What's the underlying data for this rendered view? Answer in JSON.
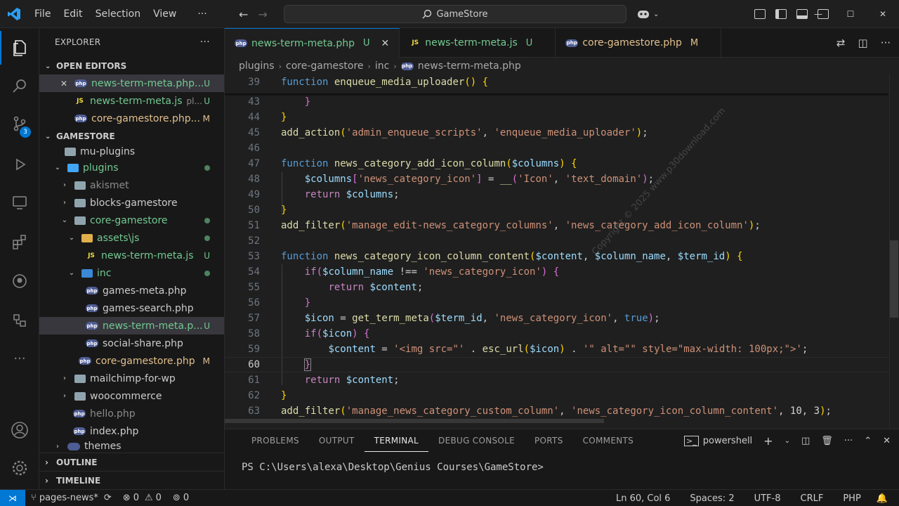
{
  "menu": [
    "File",
    "Edit",
    "Selection",
    "View"
  ],
  "menu_more": "···",
  "search": {
    "text": "GameStore"
  },
  "window": {
    "minimize": "—",
    "maximize": "☐",
    "close": "✕"
  },
  "activity": {
    "scm_badge": "3"
  },
  "explorer": {
    "title": "EXPLORER",
    "more": "···",
    "open_editors_title": "OPEN EDITORS",
    "open_editors": [
      {
        "name": "news-term-meta.php...",
        "status": "U",
        "close": "✕"
      },
      {
        "name": "news-term-meta.js",
        "hint": "pl...",
        "status": "U"
      },
      {
        "name": "core-gamestore.php...",
        "status": "M"
      }
    ],
    "workspace_title": "GAMESTORE",
    "tree": {
      "mu_plugins": "mu-plugins",
      "plugins": "plugins",
      "akismet": "akismet",
      "blocks_gamestore": "blocks-gamestore",
      "core_gamestore": "core-gamestore",
      "assets_js": "assets\\js",
      "news_term_meta_js": "news-term-meta.js",
      "news_term_meta_js_status": "U",
      "inc": "inc",
      "games_meta": "games-meta.php",
      "games_search": "games-search.php",
      "news_term_meta_php": "news-term-meta.p...",
      "news_term_meta_php_status": "U",
      "social_share": "social-share.php",
      "core_gamestore_php": "core-gamestore.php",
      "core_gamestore_php_status": "M",
      "mailchimp": "mailchimp-for-wp",
      "woocommerce": "woocommerce",
      "hello": "hello.php",
      "index": "index.php",
      "themes": "themes"
    },
    "outline": "OUTLINE",
    "timeline": "TIMELINE"
  },
  "tabs": [
    {
      "label": "news-term-meta.php",
      "status": "U",
      "close": "✕"
    },
    {
      "label": "news-term-meta.js",
      "status": "U"
    },
    {
      "label": "core-gamestore.php",
      "status": "M"
    }
  ],
  "breadcrumb": [
    "plugins",
    "core-gamestore",
    "inc",
    "news-term-meta.php"
  ],
  "editor": {
    "sticky_line": "39",
    "sticky_code": "function enqueue_media_uploader() {",
    "lines": [
      "43",
      "44",
      "45",
      "46",
      "47",
      "48",
      "49",
      "50",
      "51",
      "52",
      "53",
      "54",
      "55",
      "56",
      "57",
      "58",
      "59",
      "60",
      "61",
      "62",
      "63"
    ],
    "watermark": "Copyright © 2025 www.p30download.com"
  },
  "panel": {
    "tabs": [
      "PROBLEMS",
      "OUTPUT",
      "TERMINAL",
      "DEBUG CONSOLE",
      "PORTS",
      "COMMENTS"
    ],
    "shell": "powershell",
    "prompt": "PS C:\\Users\\alexa\\Desktop\\Genius Courses\\GameStore>"
  },
  "status": {
    "branch": "pages-news*",
    "errors": "0",
    "warnings": "0",
    "ports": "0",
    "position": "Ln 60, Col 6",
    "spaces": "Spaces: 2",
    "encoding": "UTF-8",
    "eol": "CRLF",
    "language": "PHP"
  },
  "colors": {
    "accent": "#0078d4",
    "untracked": "#73c991",
    "modified": "#e2c08d"
  }
}
